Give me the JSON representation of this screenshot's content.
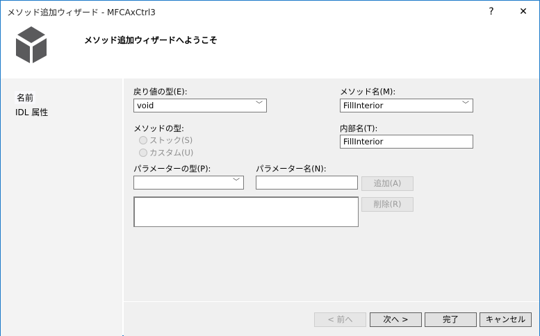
{
  "window": {
    "title": "メソッド追加ウィザード - MFCAxCtrl3",
    "help": "?",
    "close": "✕"
  },
  "header": {
    "title": "メソッド追加ウィザードへようこそ"
  },
  "nav": {
    "items": [
      {
        "label": "名前"
      },
      {
        "label": "IDL 属性"
      }
    ]
  },
  "form": {
    "return_type_label": "戻り値の型(E):",
    "return_type_value": "void",
    "method_name_label": "メソッド名(M):",
    "method_name_value": "FillInterior",
    "method_type_label": "メソッドの型:",
    "stock_label": "ストック(S)",
    "custom_label": "カスタム(U)",
    "internal_name_label": "内部名(T):",
    "internal_name_value": "FillInterior",
    "param_type_label": "パラメーターの型(P):",
    "param_type_value": "",
    "param_name_label": "パラメーター名(N):",
    "param_name_value": "",
    "add_label": "追加(A)",
    "remove_label": "削除(R)"
  },
  "footer": {
    "back": "< 前へ",
    "next": "次へ >",
    "finish": "完了",
    "cancel": "キャンセル"
  }
}
